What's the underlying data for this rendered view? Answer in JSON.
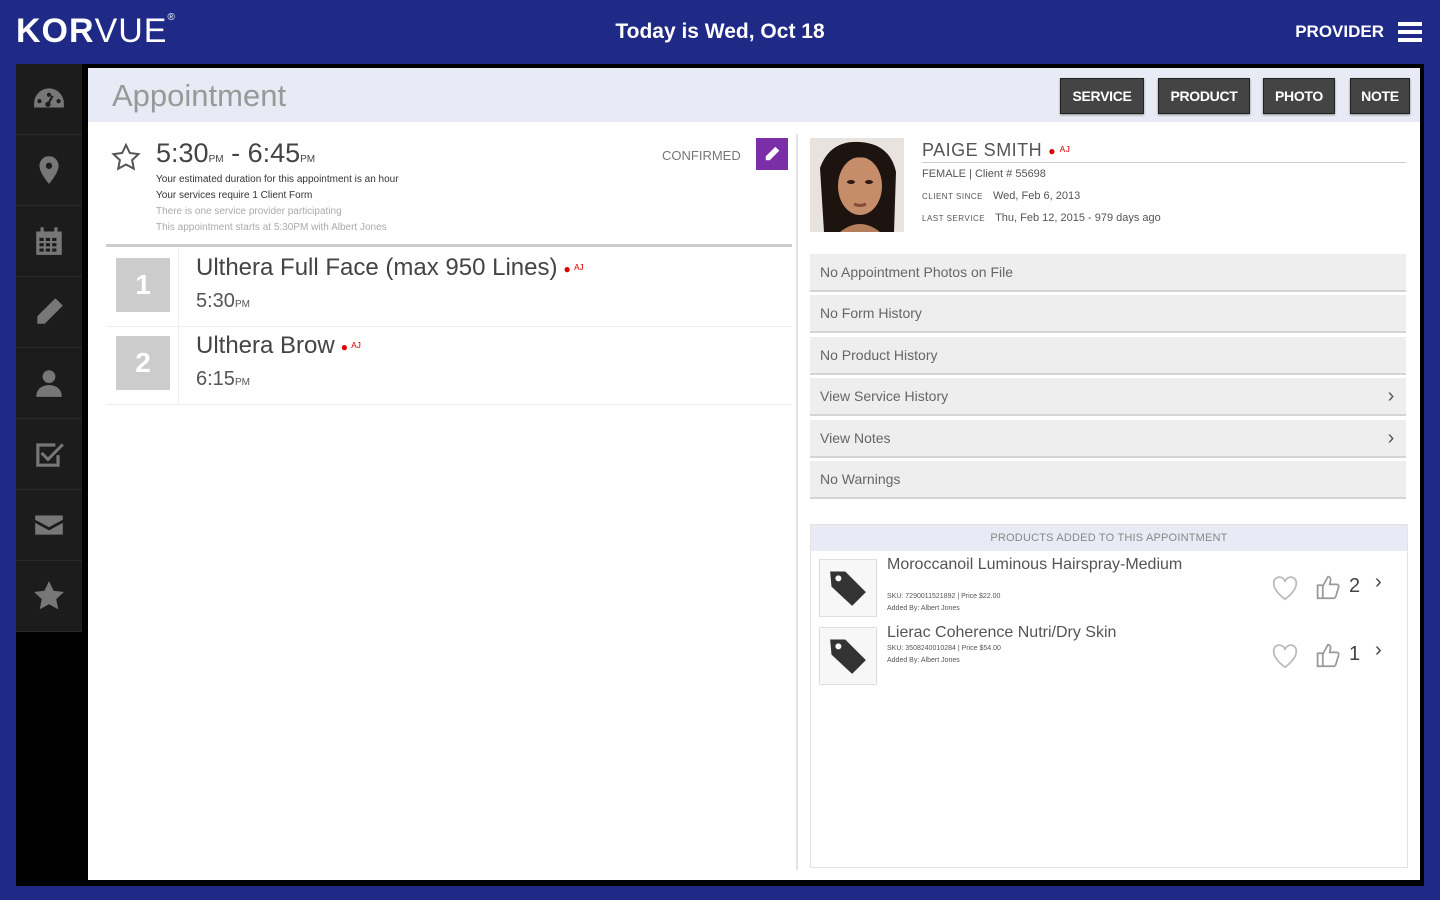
{
  "app": {
    "logo_bold": "KOR",
    "logo_light": "VUE",
    "logo_mark": "®",
    "today": "Today is Wed, Oct 18",
    "role": "PROVIDER"
  },
  "sidebar": {
    "items": [
      "dashboard-icon",
      "location-pin-icon",
      "calendar-icon",
      "pencil-icon",
      "person-icon",
      "checkbox-icon",
      "envelope-icon",
      "star-icon"
    ]
  },
  "header": {
    "title": "Appointment",
    "buttons": {
      "service": "SERVICE",
      "product": "PRODUCT",
      "photo": "PHOTO",
      "note": "NOTE"
    }
  },
  "appointment": {
    "start": "5:30",
    "start_ampm": "PM",
    "separator": " - ",
    "end": "6:45",
    "end_ampm": "PM",
    "status": "CONFIRMED",
    "lines": [
      "Your estimated duration for this appointment is an hour",
      "Your services require 1 Client Form",
      "There is one service provider participating",
      "This appointment starts at 5:30PM with Albert Jones"
    ]
  },
  "services": [
    {
      "num": "1",
      "name": "Ulthera Full Face (max 950 Lines)",
      "time": "5:30",
      "ampm": "PM",
      "marker": "● ᴬᴶ"
    },
    {
      "num": "2",
      "name": "Ulthera Brow",
      "time": "6:15",
      "ampm": "PM",
      "marker": "● ᴬᴶ"
    }
  ],
  "client": {
    "name": "PAIGE SMITH",
    "marker": "● ᴬᴶ",
    "gender_line": "FEMALE  |  Client # 55698",
    "since_label": "CLIENT SINCE",
    "since_value": "Wed, Feb 6, 2013",
    "last_label": "LAST SERVICE",
    "last_value": "Thu, Feb 12, 2015 - 979 days ago"
  },
  "info_rows": [
    {
      "label": "No Appointment Photos on File",
      "chevron": false
    },
    {
      "label": "No Form History",
      "chevron": false
    },
    {
      "label": "No Product History",
      "chevron": false
    },
    {
      "label": "View Service History",
      "chevron": true
    },
    {
      "label": "View Notes",
      "chevron": true
    },
    {
      "label": "No Warnings",
      "chevron": false
    }
  ],
  "products": {
    "heading": "PRODUCTS ADDED TO THIS APPOINTMENT",
    "items": [
      {
        "name": "Moroccanoil Luminous Hairspray-Medium",
        "sku_line": "SKU: 7290011521892  |  Price $22.00",
        "added_by": "Added By: Albert Jones",
        "qty": "2"
      },
      {
        "name": "Lierac Coherence Nutri/Dry Skin",
        "sku_line": "SKU: 3508240010284  |  Price $54.00",
        "added_by": "Added By: Albert Jones",
        "qty": "1"
      }
    ]
  },
  "colors": {
    "brand": "#1f2a86",
    "edit_button": "#7a2ea8",
    "marker": "#dd0000"
  }
}
